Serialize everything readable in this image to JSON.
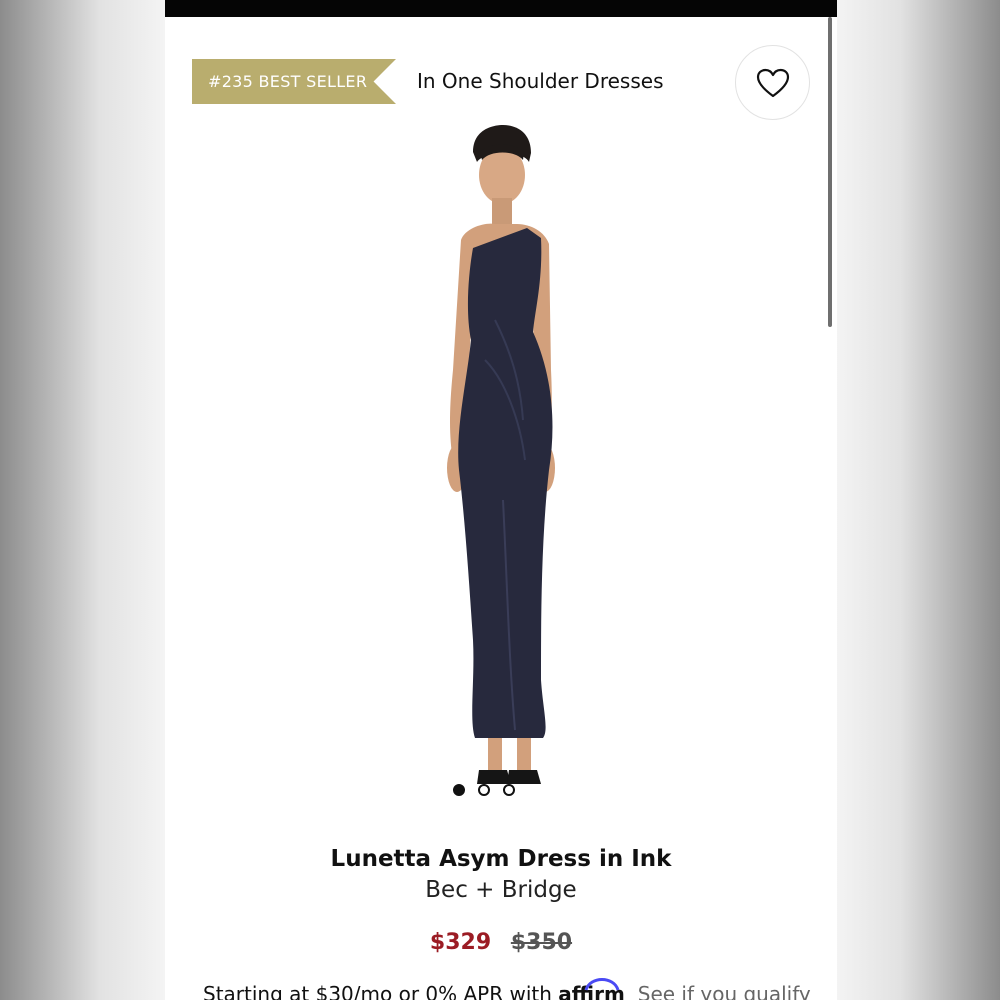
{
  "badge": {
    "label": "#235 BEST SELLER"
  },
  "category": {
    "label": "In One Shoulder Dresses"
  },
  "wishlist": {
    "icon": "heart-icon"
  },
  "gallery": {
    "count": 3,
    "active": 0
  },
  "product": {
    "name": "Lunetta Asym Dress in Ink",
    "brand": "Bec + Bridge",
    "price": "$329",
    "original_price": "$350"
  },
  "financing": {
    "prefix": "Starting at $30/mo or 0% APR with",
    "provider": "affirm",
    "link": "See if you qualify"
  },
  "colors": {
    "badge": "#b9ad6e",
    "sale_price": "#9b1c24",
    "dress": "#27293d",
    "affirm_arc": "#4a4af4"
  }
}
